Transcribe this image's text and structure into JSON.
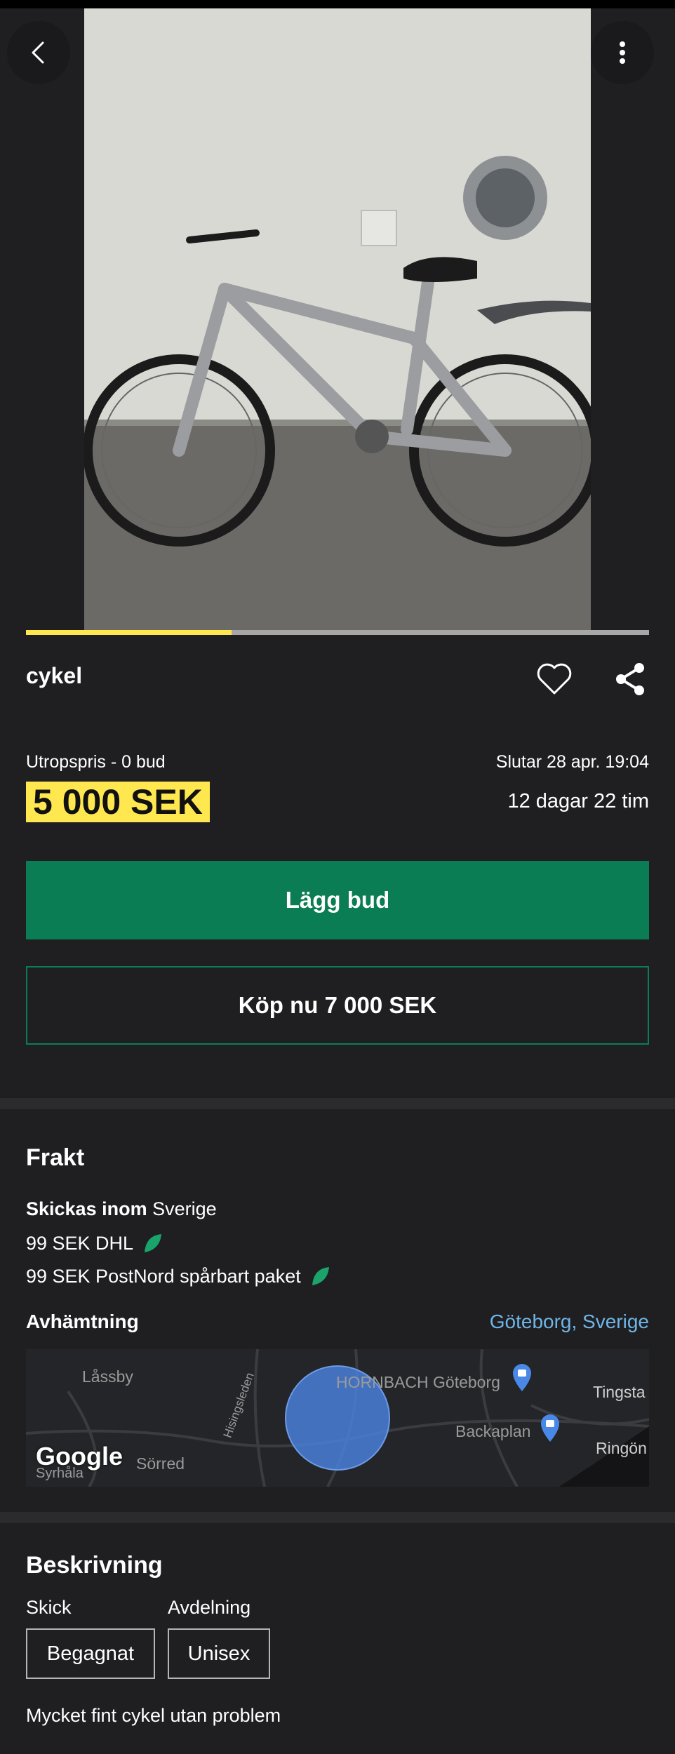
{
  "listing": {
    "title": "cykel",
    "price_label": "Utropspris - 0 bud",
    "price": "5 000 SEK",
    "ends": "Slutar 28 apr. 19:04",
    "remaining": "12 dagar 22 tim",
    "bid_button": "Lägg bud",
    "buy_now_button": "Köp nu 7 000 SEK",
    "image_progress": 0.33
  },
  "shipping": {
    "heading": "Frakt",
    "ships_label": "Skickas inom",
    "ships_country": "Sverige",
    "options": [
      {
        "text": "99 SEK DHL",
        "icon": "leaf-icon"
      },
      {
        "text": "99 SEK PostNord spårbart paket",
        "icon": "leaf-icon"
      }
    ],
    "pickup_label": "Avhämtning",
    "pickup_location": "Göteborg, Sverige"
  },
  "map": {
    "places": [
      "Låssby",
      "HORNBACH Göteborg",
      "Tingsta",
      "Backaplan",
      "Ringön",
      "Sörred",
      "Syrhåla",
      "Hisingsleden"
    ],
    "logo": "Google"
  },
  "description": {
    "heading": "Beskrivning",
    "condition_label": "Skick",
    "condition_value": "Begagnat",
    "department_label": "Avdelning",
    "department_value": "Unisex",
    "text": "Mycket fint cykel utan problem"
  },
  "colors": {
    "background": "#1f1f22",
    "accent_green": "#0b7d55",
    "price_highlight": "#ffe84f",
    "link_blue": "#6fb6e8"
  }
}
